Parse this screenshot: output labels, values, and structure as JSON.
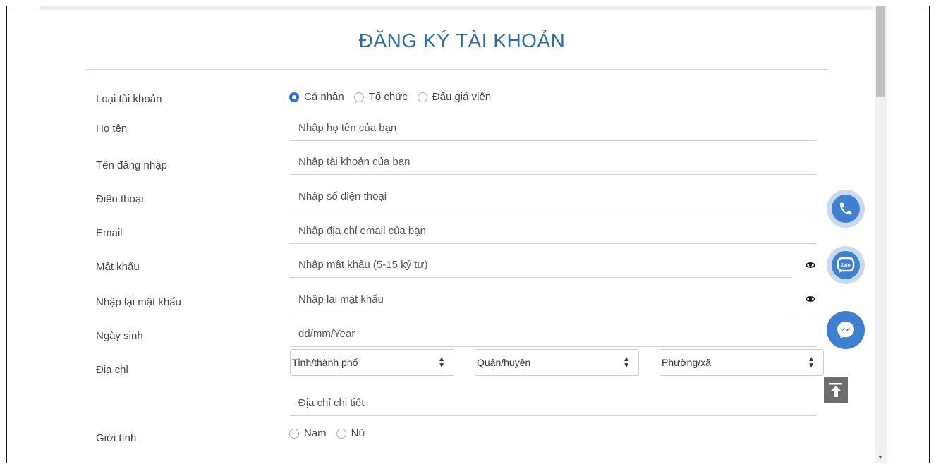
{
  "form": {
    "title": "ĐĂNG KÝ TÀI KHOẢN",
    "account_type": {
      "label": "Loại tài khoản",
      "options": [
        "Cá nhân",
        "Tổ chức",
        "Đấu giá viên"
      ],
      "selected": "Cá nhân"
    },
    "fullname": {
      "label": "Họ tên",
      "placeholder": "Nhập họ tên của bạn"
    },
    "username": {
      "label": "Tên đăng nhập",
      "placeholder": "Nhập tài khoản của bạn"
    },
    "phone": {
      "label": "Điện thoại",
      "placeholder": "Nhập số điện thoại"
    },
    "email": {
      "label": "Email",
      "placeholder": "Nhập địa chỉ email của bạn"
    },
    "password": {
      "label": "Mật khẩu",
      "placeholder": "Nhập mật khẩu (5-15 ký tự)"
    },
    "confirm_password": {
      "label": "Nhập lại mật khẩu",
      "placeholder": "Nhập lại mật khẩu"
    },
    "birthday": {
      "label": "Ngày sinh",
      "placeholder": "dd/mm/Year"
    },
    "address": {
      "label": "Địa chỉ",
      "province": "Tỉnh/thành phố",
      "district": "Quận/huyện",
      "ward": "Phường/xã",
      "detail_placeholder": "Địa chỉ chi tiết"
    },
    "gender": {
      "label": "Giới tính",
      "options": [
        "Nam",
        "Nữ"
      ]
    }
  },
  "widgets": {
    "zalo_text": "Zalo"
  },
  "colors": {
    "title": "#2e6da4",
    "radio_selected": "#2f6fd6",
    "fab": "#3f7fcf",
    "to_top": "#6d6d6d"
  },
  "icons": [
    "phone-icon",
    "zalo-icon",
    "messenger-icon",
    "arrow-up-icon",
    "eye-icon",
    "sort-caret-icon"
  ]
}
